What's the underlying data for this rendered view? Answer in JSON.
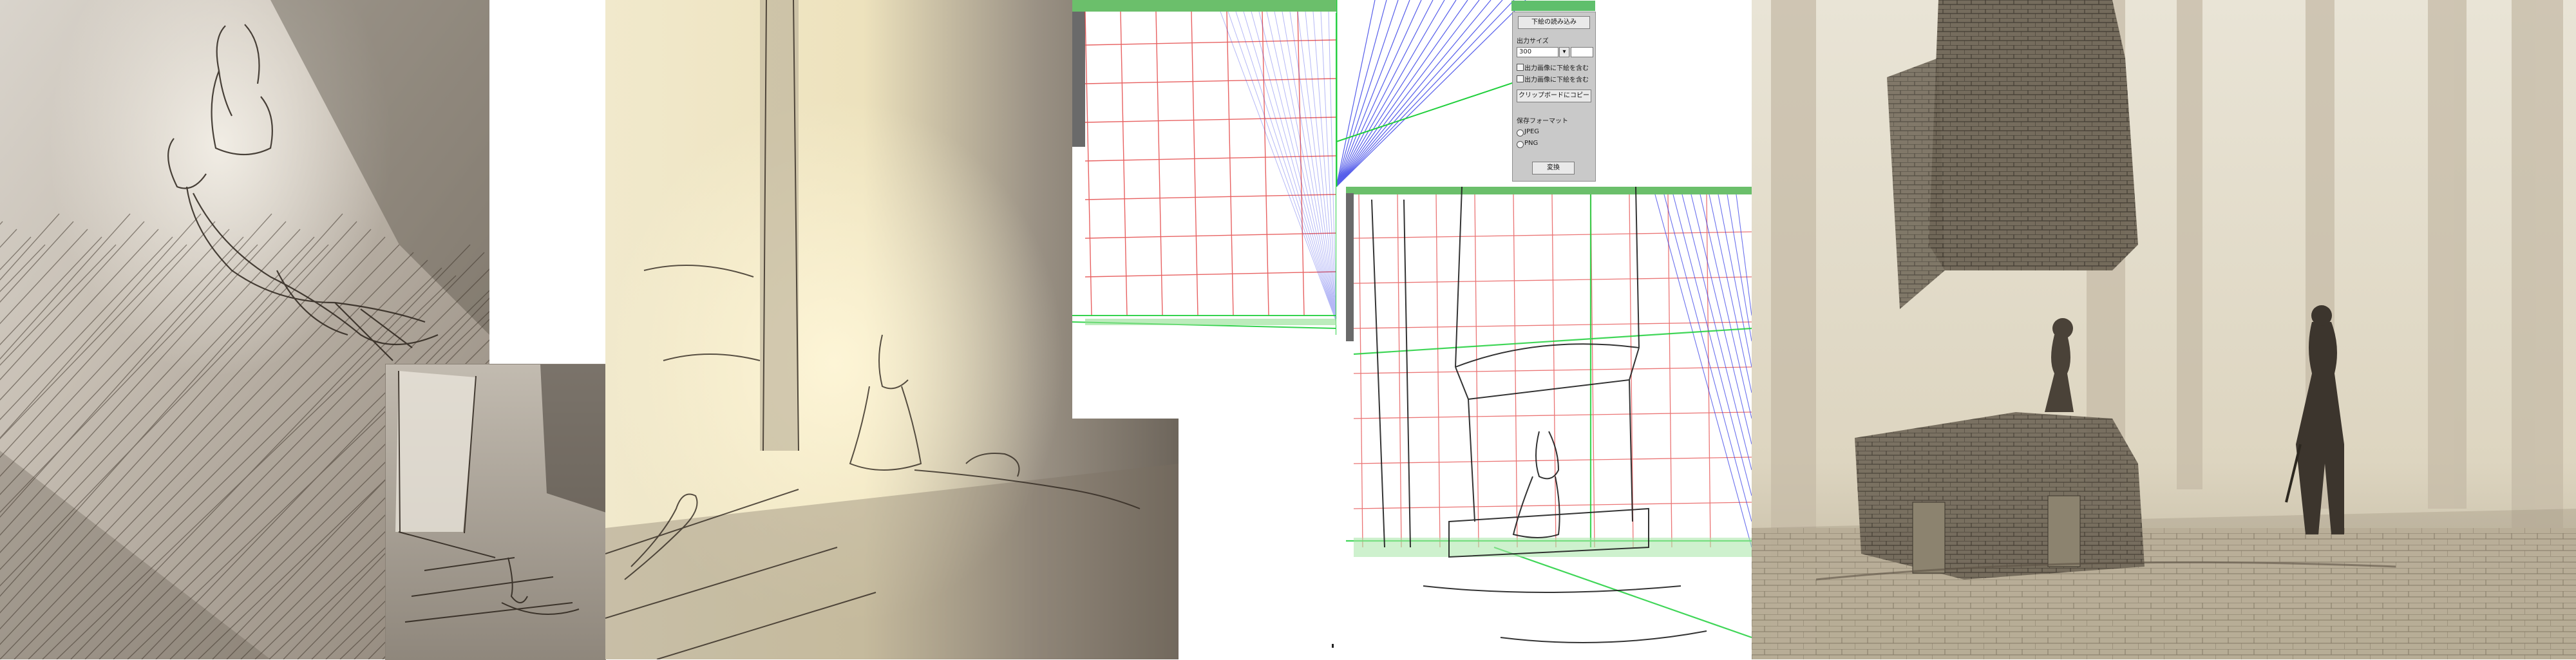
{
  "dialog": {
    "import_button": "下絵の読み込み",
    "output_size_label": "出力サイズ",
    "size_value": "300",
    "option_1": "出力画像に下絵を含む",
    "option_2": "出力画像に下絵を含む",
    "copy_button": "クリップボードにコピー",
    "save_format_label": "保存フォーマット",
    "format_jpeg": "JPEG",
    "format_png": "PNG",
    "convert_button": "変換"
  },
  "colors": {
    "perspective_red": "#e23b3b",
    "perspective_green": "#1fcf3b",
    "perspective_blue": "#2d36e6",
    "sketch_sepia": "#3b3127"
  }
}
